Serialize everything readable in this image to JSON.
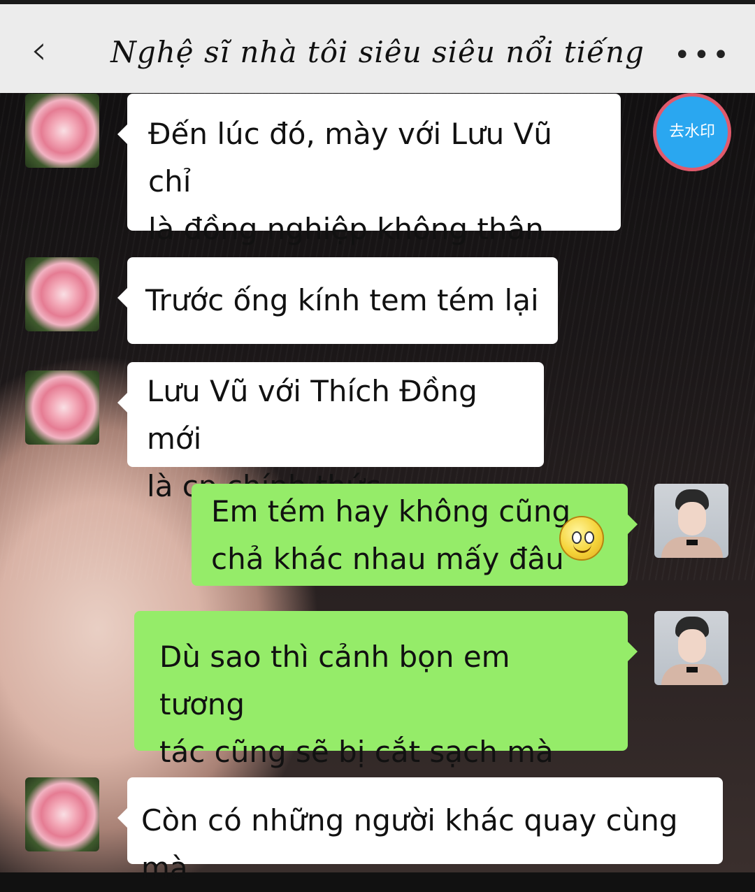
{
  "header": {
    "title": "Nghệ sĩ nhà tôi siêu siêu nổi tiếng",
    "back_icon": "chevron-left-icon",
    "more_icon": "more-dots-icon",
    "more_label": "•••"
  },
  "overlay": {
    "watermark_button_label": "去水印"
  },
  "messages": [
    {
      "side": "left",
      "avatar": "rose-avatar",
      "lines": [
        "Đến lúc đó, mày với Lưu Vũ chỉ",
        "là đồng nghiệp không thân thôi"
      ]
    },
    {
      "side": "left",
      "avatar": "rose-avatar",
      "lines": [
        "Trước ống kính tem tém lại"
      ]
    },
    {
      "side": "left",
      "avatar": "rose-avatar",
      "lines": [
        "Lưu Vũ với Thích Đồng mới",
        "là cp chính thức"
      ]
    },
    {
      "side": "right",
      "avatar": "boy-avatar",
      "lines": [
        "Em tém hay không cũng",
        "chả khác nhau mấy đâu"
      ],
      "emoji": "smile-emoji-icon"
    },
    {
      "side": "right",
      "avatar": "boy-avatar",
      "lines": [
        "Dù sao thì cảnh bọn em tương",
        "tác cũng sẽ bị cắt sạch mà"
      ]
    },
    {
      "side": "left",
      "avatar": "rose-avatar",
      "lines": [
        "Còn có những người khác quay cùng mà"
      ]
    }
  ],
  "colors": {
    "header_bg": "#ececec",
    "incoming_bubble": "#ffffff",
    "outgoing_bubble": "#95ec69",
    "watermark_button": "#2aa7f0"
  }
}
